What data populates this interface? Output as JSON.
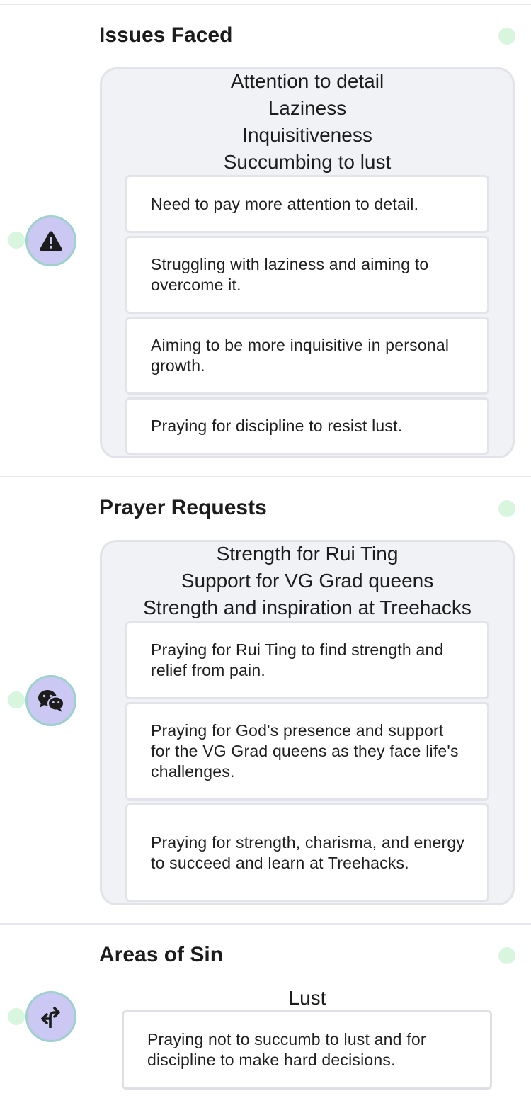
{
  "sections": [
    {
      "title": "Issues Faced",
      "icon": "warning-icon",
      "topics": [
        "Attention to detail",
        "Laziness",
        "Inquisitiveness",
        "Succumbing to lust"
      ],
      "cards": [
        "Need to pay more attention to detail.",
        "Struggling with laziness and aiming to overcome it.",
        "Aiming to be more inquisitive in personal growth.",
        "Praying for discipline to resist lust."
      ]
    },
    {
      "title": "Prayer Requests",
      "icon": "chat-bubbles-icon",
      "topics": [
        "Strength for Rui Ting",
        "Support for VG Grad queens",
        "Strength and inspiration at Treehacks"
      ],
      "cards": [
        "Praying for Rui Ting to find strength and relief from pain.",
        "Praying for God's presence and support for the VG Grad queens as they face life's challenges.",
        "Praying for strength, charisma, and energy to succeed and learn at Treehacks."
      ]
    },
    {
      "title": "Areas of Sin",
      "icon": "turn-left-arrow-icon",
      "topics": [
        "Lust"
      ],
      "cards": [
        "Praying not to succumb to lust and for discipline to make hard decisions."
      ]
    }
  ],
  "colors": {
    "status_dot": "#d8f5de",
    "node_fill": "#cbc8f3",
    "node_border": "#9ed0cc",
    "group_fill": "#f1f2f6"
  }
}
